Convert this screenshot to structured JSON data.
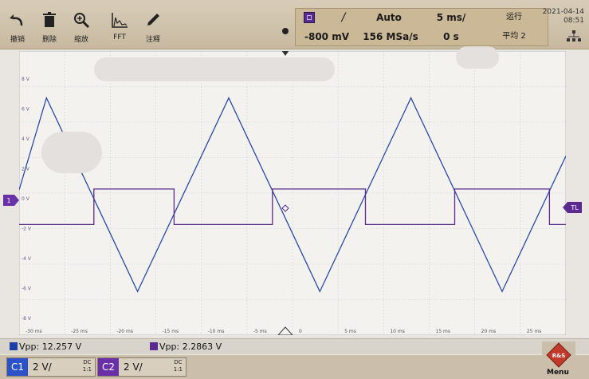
{
  "toolbar": {
    "buttons": [
      {
        "name": "undo",
        "label": "撤销"
      },
      {
        "name": "delete",
        "label": "删除"
      },
      {
        "name": "zoom",
        "label": "缩放"
      },
      {
        "name": "fft",
        "label": "FFT"
      },
      {
        "name": "annotate",
        "label": "注释"
      }
    ]
  },
  "trigger": {
    "slope_symbol": "/",
    "mode": "Auto",
    "timebase": "5 ms/",
    "level": "-800 mV",
    "sample_rate": "156 MSa/s",
    "position": "0 s",
    "run_state": "运行",
    "acquisition": "平均 2"
  },
  "datetime": {
    "date": "2021-04-14",
    "time": "08:51"
  },
  "graticule": {
    "y_labels": [
      "8 V",
      "6 V",
      "4 V",
      "2 V",
      "0 V",
      "-2 V",
      "-4 V",
      "-6 V",
      "-8 V"
    ],
    "x_labels": [
      "-30 ms",
      "-25 ms",
      "-20 ms",
      "-15 ms",
      "-10 ms",
      "-5 ms",
      "0",
      "5 ms",
      "10 ms",
      "15 ms",
      "20 ms",
      "25 ms"
    ]
  },
  "markers": {
    "ch1": "1",
    "trigger_level": "TL"
  },
  "measurements": [
    {
      "label": "Vpp: 12.257 V",
      "color": "#1f3fa8"
    },
    {
      "label": "Vpp: 2.2863 V",
      "color": "#5b2a90"
    }
  ],
  "channels": [
    {
      "name": "C1",
      "scale": "2 V/",
      "coupling": "DC",
      "coupling2": "1:1",
      "color": "#2b52c8"
    },
    {
      "name": "C2",
      "scale": "2 V/",
      "coupling": "DC",
      "coupling2": "1:1",
      "color": "#6a30a8"
    }
  ],
  "menu": {
    "label": "Menu"
  },
  "colors": {
    "ch1_trace": "#2a4aa6",
    "ch2_trace": "#5a2a8c"
  }
}
